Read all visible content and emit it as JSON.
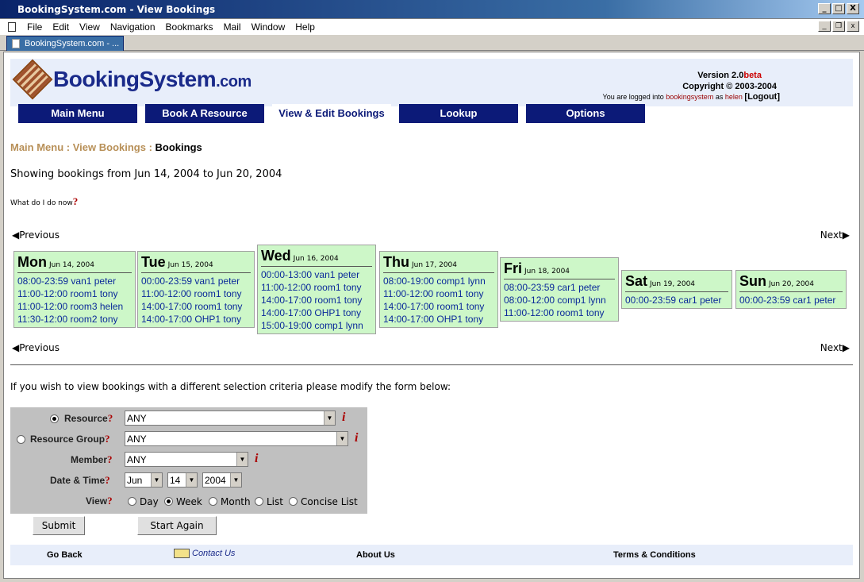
{
  "window": {
    "title": "BookingSystem.com - View Bookings",
    "controls": [
      "_",
      "□",
      "X"
    ]
  },
  "menu": [
    "File",
    "Edit",
    "View",
    "Navigation",
    "Bookmarks",
    "Mail",
    "Window",
    "Help"
  ],
  "tab": {
    "label": "BookingSystem.com - ..."
  },
  "header": {
    "logo_text": "BookingSystem",
    "logo_domain": ".com",
    "version_prefix": "Version 2.0",
    "version_suffix": "beta",
    "copyright": "Copyright © 2003-2004",
    "logged_prefix": "You are logged into",
    "logged_system": "bookingsystem",
    "logged_as": "as",
    "logged_user": "helen",
    "logout": "[Logout]"
  },
  "nav": [
    "Main Menu",
    "Book A Resource",
    "View & Edit Bookings",
    "Lookup",
    "Options"
  ],
  "breadcrumb": {
    "link1": "Main Menu",
    "sep1": " : ",
    "link2": "View Bookings",
    "sep2": " : ",
    "current": "Bookings"
  },
  "showing": "Showing bookings from Jun 14, 2004 to Jun 20, 2004",
  "help_link": "What do I do now",
  "pager": {
    "previous": "Previous",
    "next": "Next"
  },
  "days": [
    {
      "name": "Mon",
      "date": "Jun 14, 2004",
      "bookings": [
        "08:00-23:59 van1 peter",
        "11:00-12:00 room1 tony",
        "11:00-12:00 room3 helen",
        "11:30-12:00 room2 tony"
      ]
    },
    {
      "name": "Tue",
      "date": "Jun 15, 2004",
      "bookings": [
        "00:00-23:59 van1 peter",
        "11:00-12:00 room1 tony",
        "14:00-17:00 room1 tony",
        "14:00-17:00 OHP1 tony"
      ]
    },
    {
      "name": "Wed",
      "date": "Jun 16, 2004",
      "bookings": [
        "00:00-13:00 van1 peter",
        "11:00-12:00 room1 tony",
        "14:00-17:00 room1 tony",
        "14:00-17:00 OHP1 tony",
        "15:00-19:00 comp1 lynn"
      ]
    },
    {
      "name": "Thu",
      "date": "Jun 17, 2004",
      "bookings": [
        "08:00-19:00 comp1 lynn",
        "11:00-12:00 room1 tony",
        "14:00-17:00 room1 tony",
        "14:00-17:00 OHP1 tony"
      ]
    },
    {
      "name": "Fri",
      "date": "Jun 18, 2004",
      "bookings": [
        "08:00-23:59 car1 peter",
        "08:00-12:00 comp1 lynn",
        "11:00-12:00 room1 tony"
      ]
    },
    {
      "name": "Sat",
      "date": "Jun 19, 2004",
      "bookings": [
        "00:00-23:59 car1 peter"
      ]
    },
    {
      "name": "Sun",
      "date": "Jun 20, 2004",
      "bookings": [
        "00:00-23:59 car1 peter"
      ]
    }
  ],
  "modify_text": "If you wish to view bookings with a different selection criteria please modify the form below:",
  "form": {
    "resource_label": "Resource",
    "resource_value": "ANY",
    "group_label": "Resource Group",
    "group_value": "ANY",
    "member_label": "Member",
    "member_value": "ANY",
    "datetime_label": "Date & Time",
    "month": "Jun",
    "day": "14",
    "year": "2004",
    "view_label": "View",
    "view_options": [
      "Day",
      "Week",
      "Month",
      "List",
      "Concise List"
    ],
    "view_selected": "Week",
    "submit": "Submit",
    "start_again": "Start Again"
  },
  "footer": {
    "go_back": "Go Back",
    "contact": "Contact Us",
    "about": "About Us",
    "terms": "Terms & Conditions"
  },
  "colors": {
    "nav_bg": "#0c1a78",
    "day_bg": "#cdf7c8",
    "booking_text": "#0a2a9a",
    "header_bg": "#e8eefa",
    "form_bg": "#c0c0c0"
  }
}
